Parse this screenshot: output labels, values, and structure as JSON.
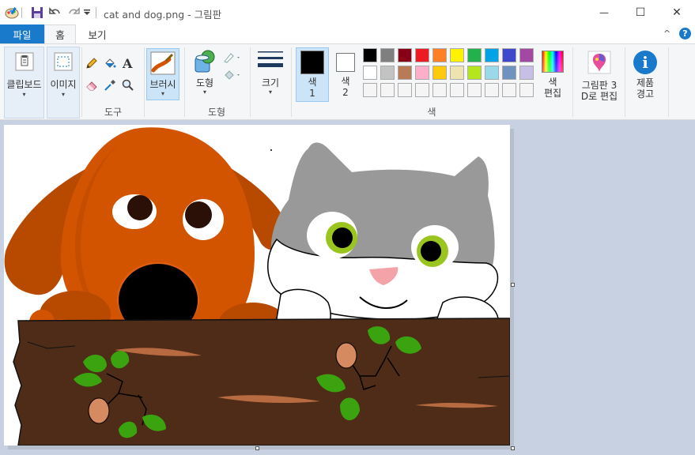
{
  "window": {
    "title": "cat and dog.png - 그림판",
    "minimize": "—",
    "maximize": "☐",
    "close": "✕"
  },
  "tabs": {
    "file": "파일",
    "home": "홈",
    "view": "보기"
  },
  "ribbon": {
    "clipboard": {
      "label": "클립보드",
      "caret": "▾"
    },
    "image": {
      "label": "이미지",
      "caret": "▾"
    },
    "tools_group": "도구",
    "brushes": {
      "label": "브러시",
      "caret": "▾"
    },
    "shapes": {
      "label": "도형",
      "caret": "▾"
    },
    "shapes_group": "도형",
    "size": {
      "label": "크기",
      "caret": "▾"
    },
    "color1": {
      "line1": "색",
      "line2": "1"
    },
    "color2": {
      "line1": "색",
      "line2": "2"
    },
    "colors_group": "색",
    "edit_colors": {
      "line1": "색",
      "line2": "편집"
    },
    "edit_3d": {
      "line1": "그림판 3",
      "line2": "D로 편집"
    },
    "product_alert": {
      "line1": "제품",
      "line2": "경고"
    },
    "collapse": "^",
    "help": "?"
  },
  "palette": {
    "row1": [
      "#000000",
      "#7f7f7f",
      "#880015",
      "#ed1c24",
      "#ff7f27",
      "#fff200",
      "#22b14c",
      "#00a2e8",
      "#3f48cc",
      "#a349a4"
    ],
    "row2": [
      "#ffffff",
      "#c3c3c3",
      "#b97a57",
      "#ffaec9",
      "#ffc90e",
      "#efe4b0",
      "#b5e61d",
      "#99d9ea",
      "#7092be",
      "#c8bfe7"
    ],
    "row3": [
      "#f5f5f5",
      "#f5f5f5",
      "#f5f5f5",
      "#f5f5f5",
      "#f5f5f5",
      "#f5f5f5",
      "#f5f5f5",
      "#f5f5f5",
      "#f5f5f5",
      "#f5f5f5"
    ]
  },
  "colors": {
    "accent": "#1979ca",
    "canvas_bg": "#c8d1e1",
    "dog": "#d35400",
    "log": "#4e2c17"
  }
}
